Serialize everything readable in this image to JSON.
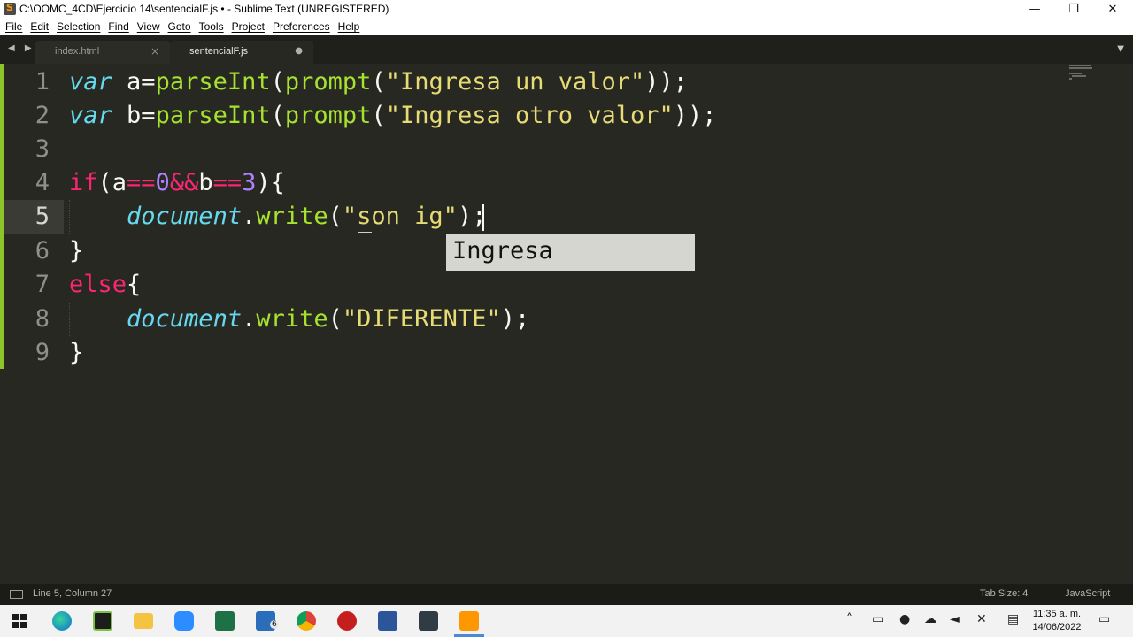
{
  "window": {
    "title": "C:\\OOMC_4CD\\Ejercicio 14\\sentencialF.js • - Sublime Text (UNREGISTERED)",
    "minimize": "—",
    "restore": "❐",
    "close": "✕"
  },
  "menu": [
    "File",
    "Edit",
    "Selection",
    "Find",
    "View",
    "Goto",
    "Tools",
    "Project",
    "Preferences",
    "Help"
  ],
  "tabs": [
    {
      "label": "index.html",
      "close": "×",
      "active": false
    },
    {
      "label": "sentencialF.js",
      "close": "●",
      "active": true
    }
  ],
  "tab_nav": "◀ ▶",
  "tab_dropdown": "▼",
  "editor": {
    "line_numbers": [
      "1",
      "2",
      "3",
      "4",
      "5",
      "6",
      "7",
      "8",
      "9"
    ],
    "active_line": 5,
    "code": {
      "l1_var": "var",
      "l1_rest_a": " a=",
      "l1_fn1": "parseInt",
      "l1_p1": "(",
      "l1_fn2": "prompt",
      "l1_p2": "(",
      "l1_str": "\"Ingresa un valor\"",
      "l1_end": "));",
      "l2_var": "var",
      "l2_rest_a": " b=",
      "l2_fn1": "parseInt",
      "l2_p1": "(",
      "l2_fn2": "prompt",
      "l2_p2": "(",
      "l2_str": "\"Ingresa otro valor\"",
      "l2_end": "));",
      "l4_if": "if",
      "l4_a": "(a",
      "l4_eq1": "==",
      "l4_zero": "0",
      "l4_and": "&&",
      "l4_b": "b",
      "l4_eq2": "==",
      "l4_three": "3",
      "l4_end": "){",
      "l5_indent": "    ",
      "l5_obj": "document",
      "l5_dot": ".",
      "l5_fn": "write",
      "l5_p": "(",
      "l5_str": "\"son ig\"",
      "l5_end": ");",
      "l6": "}",
      "l7_else": "else",
      "l7_end": "{",
      "l8_indent": "    ",
      "l8_obj": "document",
      "l8_dot": ".",
      "l8_fn": "write",
      "l8_p": "(",
      "l8_str": "\"DIFERENTE\"",
      "l8_end": ");",
      "l9": "}"
    },
    "autocomplete": [
      "Ingresa"
    ]
  },
  "status": {
    "position": "Line 5, Column 27",
    "tab_size": "Tab Size: 4",
    "syntax": "JavaScript"
  },
  "taskbar": {
    "time": "11:35 a. m.",
    "date": "14/06/2022",
    "mail_badge": "6"
  }
}
